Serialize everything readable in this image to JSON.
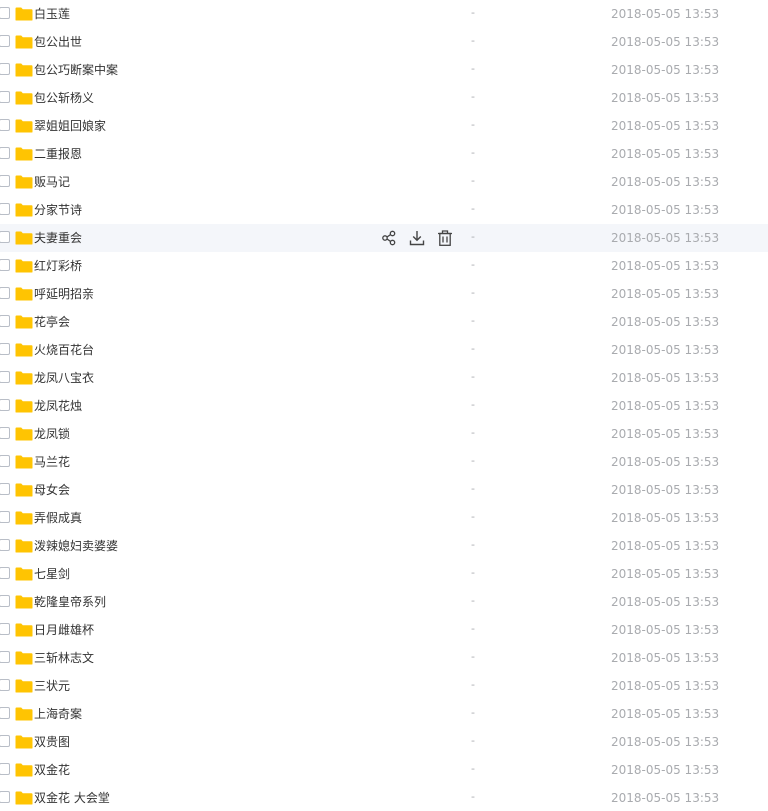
{
  "files": [
    {
      "name": "白玉莲",
      "size": "-",
      "modified": "2018-05-05 13:53"
    },
    {
      "name": "包公出世",
      "size": "-",
      "modified": "2018-05-05 13:53"
    },
    {
      "name": "包公巧断案中案",
      "size": "-",
      "modified": "2018-05-05 13:53"
    },
    {
      "name": "包公斩杨义",
      "size": "-",
      "modified": "2018-05-05 13:53"
    },
    {
      "name": "翠姐姐回娘家",
      "size": "-",
      "modified": "2018-05-05 13:53"
    },
    {
      "name": "二重报恩",
      "size": "-",
      "modified": "2018-05-05 13:53"
    },
    {
      "name": "贩马记",
      "size": "-",
      "modified": "2018-05-05 13:53"
    },
    {
      "name": "分家节诗",
      "size": "-",
      "modified": "2018-05-05 13:53"
    },
    {
      "name": "夫妻重会",
      "size": "-",
      "modified": "2018-05-05 13:53",
      "hovered": true
    },
    {
      "name": "红灯彩桥",
      "size": "-",
      "modified": "2018-05-05 13:53"
    },
    {
      "name": "呼延明招亲",
      "size": "-",
      "modified": "2018-05-05 13:53"
    },
    {
      "name": "花亭会",
      "size": "-",
      "modified": "2018-05-05 13:53"
    },
    {
      "name": "火烧百花台",
      "size": "-",
      "modified": "2018-05-05 13:53"
    },
    {
      "name": "龙凤八宝衣",
      "size": "-",
      "modified": "2018-05-05 13:53"
    },
    {
      "name": "龙凤花烛",
      "size": "-",
      "modified": "2018-05-05 13:53"
    },
    {
      "name": "龙凤锁",
      "size": "-",
      "modified": "2018-05-05 13:53"
    },
    {
      "name": "马兰花",
      "size": "-",
      "modified": "2018-05-05 13:53"
    },
    {
      "name": "母女会",
      "size": "-",
      "modified": "2018-05-05 13:53"
    },
    {
      "name": "弄假成真",
      "size": "-",
      "modified": "2018-05-05 13:53"
    },
    {
      "name": "泼辣媳妇卖婆婆",
      "size": "-",
      "modified": "2018-05-05 13:53"
    },
    {
      "name": "七星剑",
      "size": "-",
      "modified": "2018-05-05 13:53"
    },
    {
      "name": "乾隆皇帝系列",
      "size": "-",
      "modified": "2018-05-05 13:53"
    },
    {
      "name": "日月雌雄杯",
      "size": "-",
      "modified": "2018-05-05 13:53"
    },
    {
      "name": "三斩林志文",
      "size": "-",
      "modified": "2018-05-05 13:53"
    },
    {
      "name": "三状元",
      "size": "-",
      "modified": "2018-05-05 13:53"
    },
    {
      "name": "上海奇案",
      "size": "-",
      "modified": "2018-05-05 13:53"
    },
    {
      "name": "双贵图",
      "size": "-",
      "modified": "2018-05-05 13:53"
    },
    {
      "name": "双金花",
      "size": "-",
      "modified": "2018-05-05 13:53"
    },
    {
      "name": "双金花 大会堂",
      "size": "-",
      "modified": "2018-05-05 13:53"
    }
  ],
  "row_actions": {
    "share_icon": "share-icon",
    "download_icon": "download-icon",
    "delete_icon": "trash-icon"
  },
  "colors": {
    "folder": "#ffc402",
    "hover_row": "#f4f6fa",
    "text": "#333333",
    "muted": "#a9abaf"
  }
}
